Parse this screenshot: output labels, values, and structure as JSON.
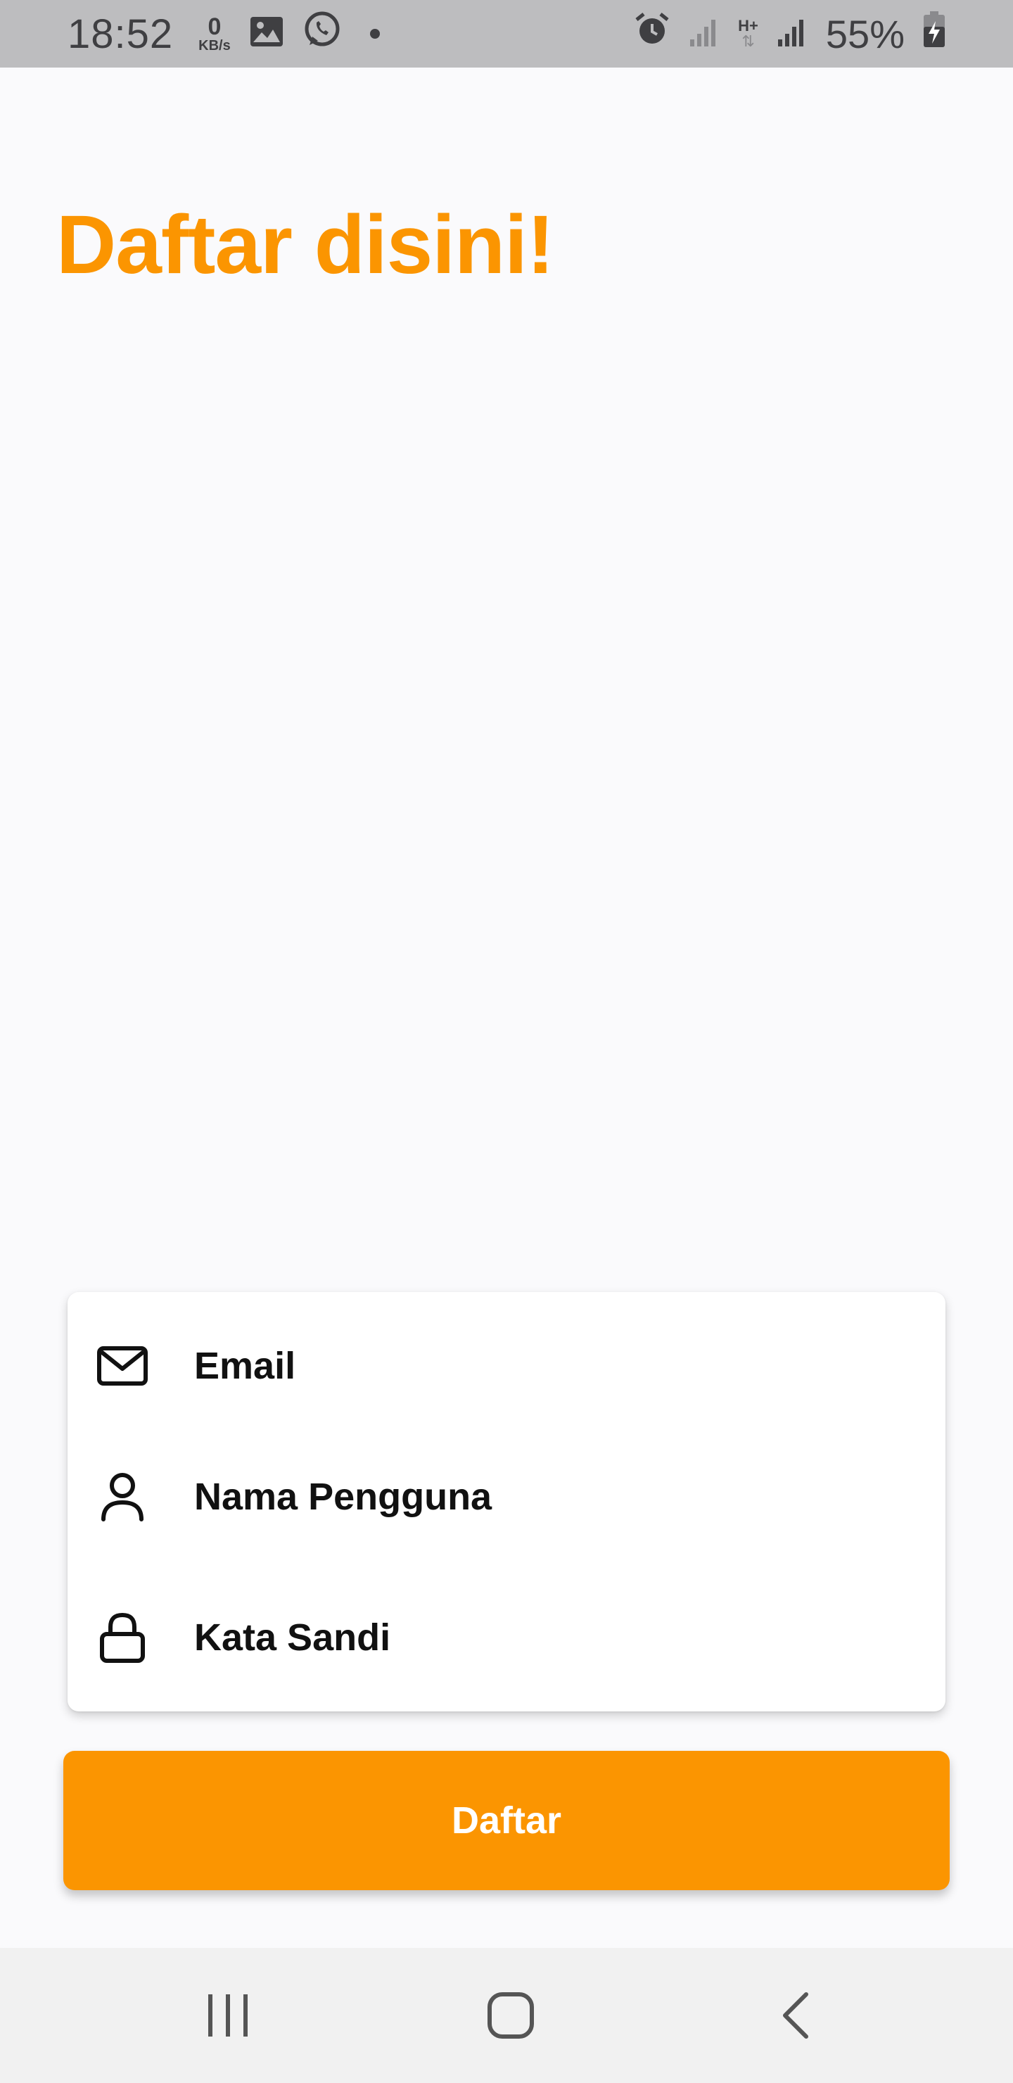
{
  "status_bar": {
    "time": "18:52",
    "net_speed_value": "0",
    "net_speed_unit": "KB/s",
    "network_type": "H+",
    "battery": "55%",
    "icons": [
      "gallery-icon",
      "whatsapp-icon",
      "notification-dot",
      "alarm-icon",
      "signal-icon",
      "signal-icon",
      "battery-charging-icon"
    ]
  },
  "page": {
    "title": "Daftar disini!"
  },
  "form": {
    "fields": [
      {
        "label": "Email",
        "icon": "mail-icon"
      },
      {
        "label": "Nama Pengguna",
        "icon": "user-icon"
      },
      {
        "label": "Kata Sandi",
        "icon": "lock-icon"
      }
    ],
    "submit_label": "Daftar"
  },
  "colors": {
    "accent": "#fb9501",
    "background": "#fafafc",
    "status_bar": "#bdbdbf",
    "nav_bar": "#f1f1f1"
  },
  "nav_bar": {
    "buttons": [
      "recent-apps-icon",
      "home-icon",
      "back-icon"
    ]
  }
}
